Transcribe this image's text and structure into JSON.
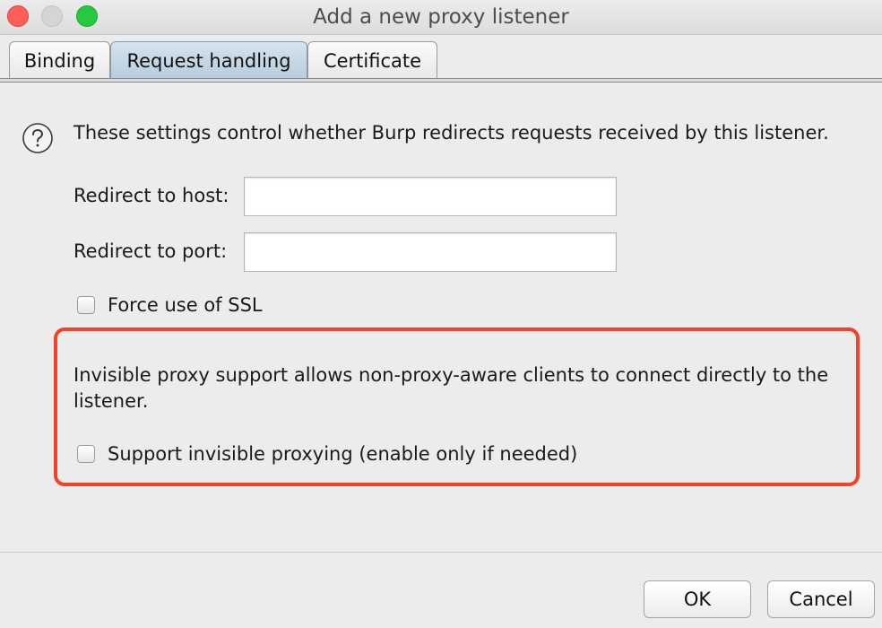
{
  "window": {
    "title": "Add a new proxy listener"
  },
  "tabs": [
    {
      "label": "Binding",
      "active": false
    },
    {
      "label": "Request handling",
      "active": true
    },
    {
      "label": "Certificate",
      "active": false
    }
  ],
  "content": {
    "help_text": "These settings control whether Burp redirects requests received by this listener.",
    "redirect_host": {
      "label": "Redirect to host:",
      "value": "",
      "placeholder": ""
    },
    "redirect_port": {
      "label": "Redirect to port:",
      "value": "",
      "placeholder": ""
    },
    "force_ssl": {
      "label": "Force use of SSL",
      "checked": false
    },
    "invisible_description": "Invisible proxy support allows non-proxy-aware clients to connect directly to the listener.",
    "invisible_proxy": {
      "label": "Support invisible proxying (enable only if needed)",
      "checked": false
    }
  },
  "footer": {
    "ok_label": "OK",
    "cancel_label": "Cancel"
  },
  "colors": {
    "highlight": "#f0442a",
    "active_tab": "#c4d6e4",
    "close": "#fe5f57",
    "minimize": "#d5d5d5",
    "maximize": "#28c840"
  },
  "icons": {
    "help": "question-circle-icon"
  }
}
